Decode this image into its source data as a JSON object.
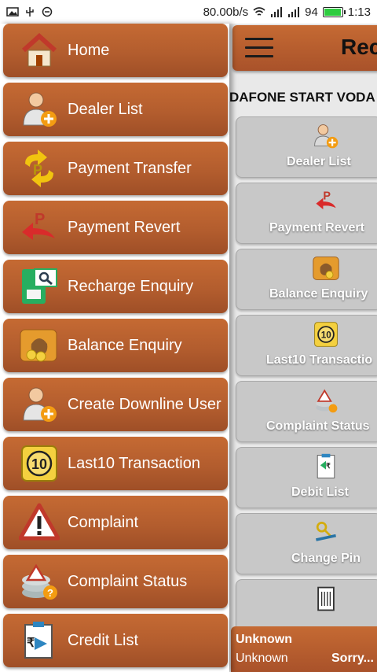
{
  "status_bar": {
    "speed": "80.00b/s",
    "battery": "94",
    "time": "1:13",
    "icons": [
      "image-icon",
      "usb-icon",
      "sync-icon",
      "wifi-icon",
      "signal-icon",
      "signal-icon",
      "battery-icon"
    ]
  },
  "drawer": {
    "items": [
      {
        "label": "Home",
        "icon": "home-icon"
      },
      {
        "label": "Dealer List",
        "icon": "user-add-icon"
      },
      {
        "label": "Payment Transfer",
        "icon": "transfer-icon"
      },
      {
        "label": "Payment Revert",
        "icon": "revert-icon"
      },
      {
        "label": "Recharge Enquiry",
        "icon": "sim-search-icon"
      },
      {
        "label": "Balance Enquiry",
        "icon": "money-bag-icon"
      },
      {
        "label": "Create Downline User",
        "icon": "user-add-icon"
      },
      {
        "label": "Last10 Transaction",
        "icon": "ten-coin-icon"
      },
      {
        "label": "Complaint",
        "icon": "warning-icon"
      },
      {
        "label": "Complaint Status",
        "icon": "complaint-status-icon"
      },
      {
        "label": "Credit List",
        "icon": "credit-list-icon"
      }
    ]
  },
  "main": {
    "title": "Rec",
    "ticker": "DAFONE START VODA",
    "tiles": [
      {
        "label": "Dealer List",
        "icon": "user-add-icon"
      },
      {
        "label": "Payment Revert",
        "icon": "revert-icon"
      },
      {
        "label": "Balance Enquiry",
        "icon": "money-bag-icon"
      },
      {
        "label": "Last10 Transactio",
        "icon": "ten-coin-icon"
      },
      {
        "label": "Complaint Status",
        "icon": "complaint-status-icon"
      },
      {
        "label": "Debit List",
        "icon": "debit-list-icon"
      },
      {
        "label": "Change Pin",
        "icon": "key-pen-icon"
      },
      {
        "label": "",
        "icon": "document-icon"
      }
    ],
    "bottom": {
      "line1": "Unknown",
      "line2": "Unknown",
      "line3": "Sorry..."
    }
  },
  "colors": {
    "accent": "#b35d2e",
    "drawer_text": "#ffffff"
  }
}
